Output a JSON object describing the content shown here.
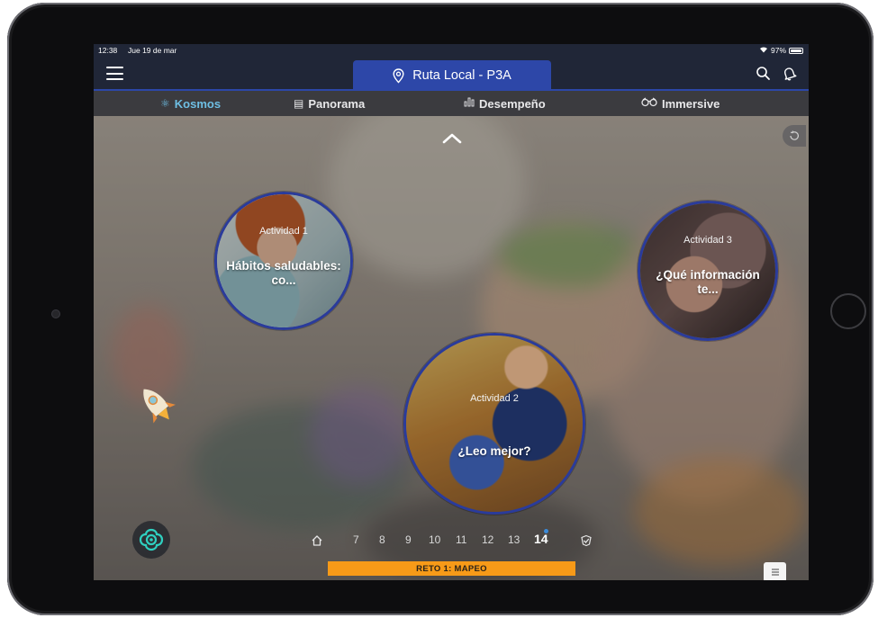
{
  "status_bar": {
    "time": "12:38",
    "date": "Jue 19 de mar",
    "battery": "97%"
  },
  "header": {
    "title": "Ruta Local - P3A"
  },
  "tabs": [
    {
      "label": "Kosmos",
      "icon": "atom-icon",
      "active": true
    },
    {
      "label": "Panorama",
      "icon": "newspaper-icon",
      "active": false
    },
    {
      "label": "Desempeño",
      "icon": "bar-chart-icon",
      "active": false
    },
    {
      "label": "Immersive",
      "icon": "vr-goggles-icon",
      "active": false
    }
  ],
  "activities": [
    {
      "label": "Actividad 1",
      "title": "Hábitos saludables: co..."
    },
    {
      "label": "Actividad 2",
      "title": "¿Leo mejor?"
    },
    {
      "label": "Actividad 3",
      "title": "¿Qué información te..."
    }
  ],
  "pager": {
    "pages": [
      "7",
      "8",
      "9",
      "10",
      "11",
      "12",
      "13",
      "14"
    ],
    "current": "14"
  },
  "challenge": {
    "label": "RETO 1: MAPEO"
  },
  "colors": {
    "accent_blue": "#2d47a8",
    "active_tab": "#6ebfe4",
    "challenge_orange": "#f79a18",
    "bar_dark": "#202637"
  }
}
